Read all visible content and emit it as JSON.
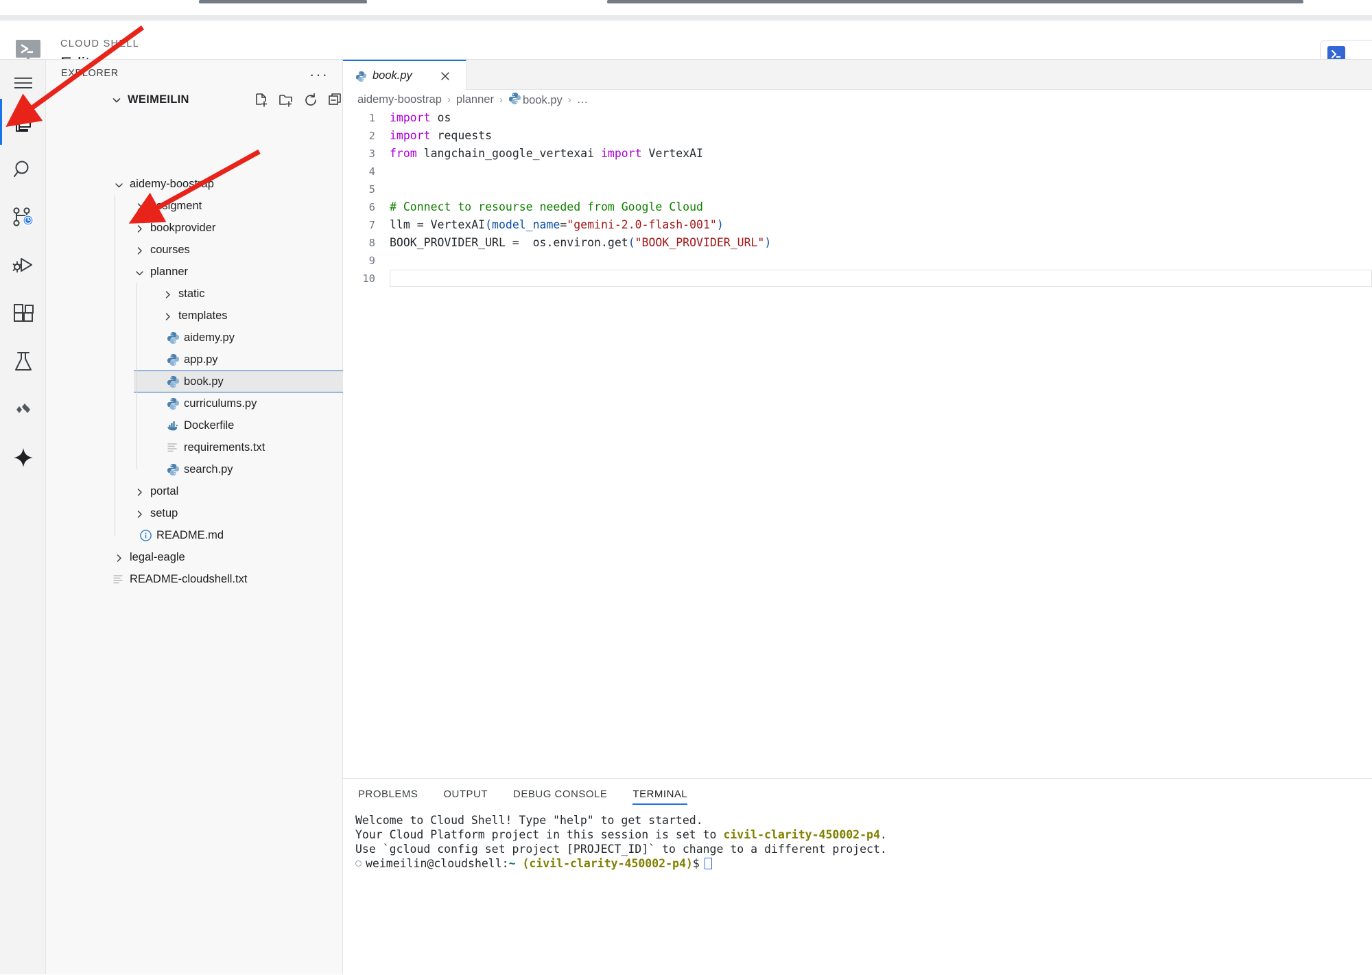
{
  "header": {
    "eyebrow": "CLOUD SHELL",
    "title": "Editor",
    "logo_icon": "cloud-shell-terminal-icon",
    "open_terminal_icon": "terminal-prompt-icon"
  },
  "activity_bar": {
    "items": [
      {
        "name": "menu-icon",
        "label": "Menu",
        "active": false
      },
      {
        "name": "explorer-files-icon",
        "label": "Explorer",
        "active": true
      },
      {
        "name": "search-icon",
        "label": "Search",
        "active": false
      },
      {
        "name": "source-control-icon",
        "label": "Source Control",
        "active": false
      },
      {
        "name": "run-and-debug-icon",
        "label": "Run and Debug",
        "active": false
      },
      {
        "name": "extensions-icon",
        "label": "Extensions",
        "active": false
      },
      {
        "name": "testing-flask-icon",
        "label": "Testing",
        "active": false
      },
      {
        "name": "cloud-code-icon",
        "label": "Cloud Code",
        "active": false
      },
      {
        "name": "gemini-sparkle-icon",
        "label": "Gemini",
        "active": false
      }
    ]
  },
  "sidebar": {
    "title": "EXPLORER",
    "more_label": "···",
    "root": "WEIMEILIN",
    "toolbar": [
      {
        "name": "new-file-icon",
        "label": "New File"
      },
      {
        "name": "new-folder-icon",
        "label": "New Folder"
      },
      {
        "name": "refresh-icon",
        "label": "Refresh Explorer"
      },
      {
        "name": "collapse-all-icon",
        "label": "Collapse Folders in Explorer"
      }
    ],
    "tree": [
      {
        "label": "aidemy-boostrap",
        "type": "folder",
        "state": "open",
        "depth": 1,
        "icon": "chevron-down-icon"
      },
      {
        "label": "assigment",
        "type": "folder",
        "state": "closed",
        "depth": 2,
        "icon": "chevron-right-icon"
      },
      {
        "label": "bookprovider",
        "type": "folder",
        "state": "closed",
        "depth": 2,
        "icon": "chevron-right-icon"
      },
      {
        "label": "courses",
        "type": "folder",
        "state": "closed",
        "depth": 2,
        "icon": "chevron-right-icon"
      },
      {
        "label": "planner",
        "type": "folder",
        "state": "open",
        "depth": 2,
        "icon": "chevron-down-icon"
      },
      {
        "label": "static",
        "type": "folder",
        "state": "closed",
        "depth": 3,
        "icon": "chevron-right-icon"
      },
      {
        "label": "templates",
        "type": "folder",
        "state": "closed",
        "depth": 3,
        "icon": "chevron-right-icon"
      },
      {
        "label": "aidemy.py",
        "type": "file",
        "depth": 3,
        "icon": "python-file-icon"
      },
      {
        "label": "app.py",
        "type": "file",
        "depth": 3,
        "icon": "python-file-icon"
      },
      {
        "label": "book.py",
        "type": "file",
        "depth": 3,
        "icon": "python-file-icon",
        "selected": true
      },
      {
        "label": "curriculums.py",
        "type": "file",
        "depth": 3,
        "icon": "python-file-icon"
      },
      {
        "label": "Dockerfile",
        "type": "file",
        "depth": 3,
        "icon": "docker-file-icon"
      },
      {
        "label": "requirements.txt",
        "type": "file",
        "depth": 3,
        "icon": "text-file-icon"
      },
      {
        "label": "search.py",
        "type": "file",
        "depth": 3,
        "icon": "python-file-icon"
      },
      {
        "label": "portal",
        "type": "folder",
        "state": "closed",
        "depth": 2,
        "icon": "chevron-right-icon"
      },
      {
        "label": "setup",
        "type": "folder",
        "state": "closed",
        "depth": 2,
        "icon": "chevron-right-icon"
      },
      {
        "label": "README.md",
        "type": "file",
        "depth": 2,
        "icon": "markdown-info-icon"
      },
      {
        "label": "legal-eagle",
        "type": "folder",
        "state": "closed",
        "depth": 1,
        "icon": "chevron-right-icon"
      },
      {
        "label": "README-cloudshell.txt",
        "type": "file",
        "depth": 1,
        "icon": "text-file-icon"
      }
    ]
  },
  "editor": {
    "tab": {
      "label": "book.py",
      "icon": "python-file-icon",
      "close_icon": "close-icon",
      "dirty": false
    },
    "breadcrumb": [
      {
        "label": "aidemy-boostrap",
        "icon": null
      },
      {
        "label": "planner",
        "icon": null
      },
      {
        "label": "book.py",
        "icon": "python-file-icon"
      },
      {
        "label": "…",
        "icon": null
      }
    ],
    "breadcrumb_separator": "›",
    "current_line": 10,
    "lines": [
      {
        "n": 1,
        "tokens": [
          {
            "t": "import",
            "c": "kw"
          },
          {
            "t": " os",
            "c": "pun"
          }
        ]
      },
      {
        "n": 2,
        "tokens": [
          {
            "t": "import",
            "c": "kw"
          },
          {
            "t": " requests",
            "c": "pun"
          }
        ]
      },
      {
        "n": 3,
        "tokens": [
          {
            "t": "from",
            "c": "kw"
          },
          {
            "t": " langchain_google_vertexai ",
            "c": "pun"
          },
          {
            "t": "import",
            "c": "kw"
          },
          {
            "t": " VertexAI",
            "c": "pun"
          }
        ]
      },
      {
        "n": 4,
        "tokens": []
      },
      {
        "n": 5,
        "tokens": []
      },
      {
        "n": 6,
        "tokens": [
          {
            "t": "# Connect to resourse needed from Google Cloud",
            "c": "cm"
          }
        ]
      },
      {
        "n": 7,
        "tokens": [
          {
            "t": "llm = VertexAI",
            "c": "pun"
          },
          {
            "t": "(",
            "c": "par"
          },
          {
            "t": "model_name",
            "c": "par"
          },
          {
            "t": "=",
            "c": "pun"
          },
          {
            "t": "\"gemini-2.0-flash-001\"",
            "c": "str"
          },
          {
            "t": ")",
            "c": "par"
          }
        ]
      },
      {
        "n": 8,
        "tokens": [
          {
            "t": "BOOK_PROVIDER_URL =  os.environ.get",
            "c": "pun"
          },
          {
            "t": "(",
            "c": "par"
          },
          {
            "t": "\"BOOK_PROVIDER_URL\"",
            "c": "str"
          },
          {
            "t": ")",
            "c": "par"
          }
        ]
      },
      {
        "n": 9,
        "tokens": []
      },
      {
        "n": 10,
        "tokens": []
      }
    ]
  },
  "panel": {
    "tabs": [
      {
        "label": "PROBLEMS",
        "active": false
      },
      {
        "label": "OUTPUT",
        "active": false
      },
      {
        "label": "DEBUG CONSOLE",
        "active": false
      },
      {
        "label": "TERMINAL",
        "active": true
      }
    ],
    "terminal": {
      "line1": "Welcome to Cloud Shell! Type \"help\" to get started.",
      "line2_pre": "Your Cloud Platform project in this session is set to ",
      "line2_project": "civil-clarity-450002-p4",
      "line2_post": ".",
      "line3": "Use `gcloud config set project [PROJECT_ID]` to change to a different project.",
      "prompt_user": "weimeilin@cloudshell:",
      "prompt_tilde": "~",
      "prompt_project": " (civil-clarity-450002-p4)",
      "prompt_sigil": "$"
    }
  },
  "annotations": {
    "arrow_color": "#e8231a",
    "arrows": [
      {
        "name": "arrow-to-explorer-icon",
        "target": "explorer-files-icon"
      },
      {
        "name": "arrow-to-planner-folder",
        "target": "planner"
      }
    ]
  },
  "colors": {
    "accent": "#1a73e8",
    "keyword": "#af00db",
    "comment": "#108000",
    "string": "#a31515",
    "param": "#0f4fa8",
    "terminal_project": "#808000",
    "selection_bg": "#e8e8e8",
    "selection_border": "#2a6bc2"
  }
}
